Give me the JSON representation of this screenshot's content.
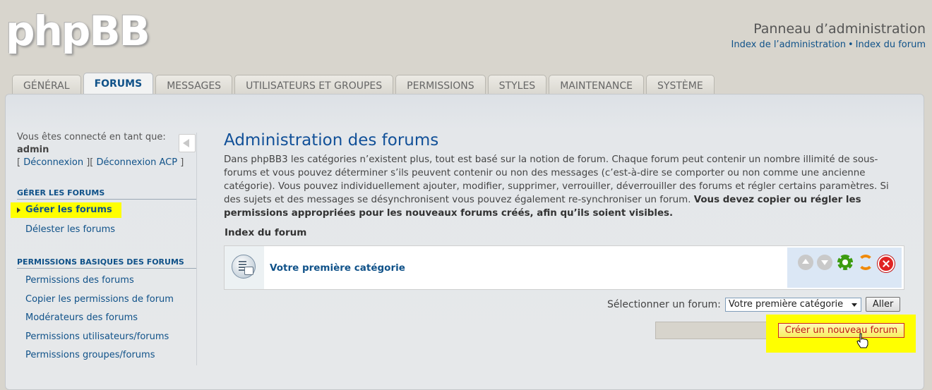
{
  "header": {
    "logo": "phpBB",
    "title": "Panneau d’administration",
    "links": [
      "Index de l’administration",
      "Index du forum"
    ],
    "link_sep": "•"
  },
  "tabs": [
    "GÉNÉRAL",
    "FORUMS",
    "MESSAGES",
    "UTILISATEURS ET GROUPES",
    "PERMISSIONS",
    "STYLES",
    "MAINTENANCE",
    "SYSTÈME"
  ],
  "active_tab": "FORUMS",
  "sidebar": {
    "logged_in_text": "Vous êtes connecté en tant que:",
    "username": "admin",
    "logout": "Déconnexion",
    "logout_acp": "Déconnexion ACP",
    "sections": [
      {
        "title": "GÉRER LES FORUMS",
        "items": [
          "Gérer les forums",
          "Délester les forums"
        ]
      },
      {
        "title": "PERMISSIONS BASIQUES DES FORUMS",
        "items": [
          "Permissions des forums",
          "Copier les permissions de forum",
          "Modérateurs des forums",
          "Permissions utilisateurs/forums",
          "Permissions groupes/forums"
        ]
      }
    ],
    "current_item": "Gérer les forums"
  },
  "main": {
    "title": "Administration des forums",
    "intro": "Dans phpBB3 les catégories n’existent plus, tout est basé sur la notion de forum. Chaque forum peut contenir un nombre illimité de sous-forums et vous pouvez déterminer s’ils peuvent contenir ou non des messages (c’est-à-dire se comporter ou non comme une ancienne catégorie). Vous pouvez individuellement ajouter, modifier, supprimer, verrouiller, déverrouiller des forums et régler certains paramètres. Si des sujets et des messages se désynchronisent vous pouvez également re-synchroniser un forum.",
    "intro_bold": "Vous devez copier ou régler les permissions appropriées pour les nouveaux forums créés, afin qu’ils soient visibles.",
    "index_label": "Index du forum",
    "category": "Votre première catégorie",
    "select_label": "Sélectionner un forum:",
    "select_value": "Votre première catégorie",
    "go_button": "Aller",
    "create_button": "Créer un nouveau forum"
  },
  "colors": {
    "link": "#105289",
    "highlight": "#ffff00",
    "title": "#115098"
  }
}
